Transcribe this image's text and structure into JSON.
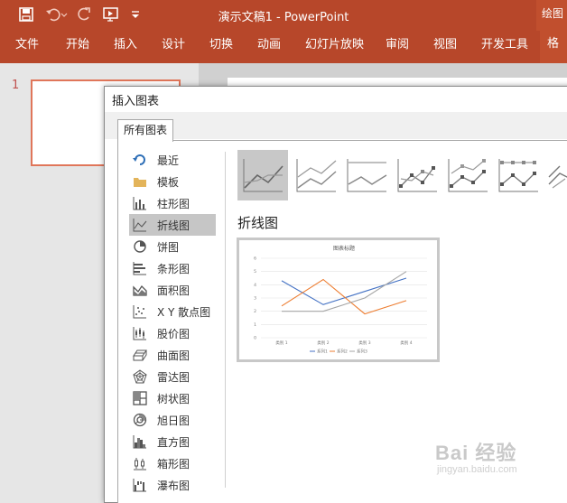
{
  "window": {
    "title": "演示文稿1  -  PowerPoint",
    "right_tab": "绘图"
  },
  "quick_access": [
    "save-icon",
    "undo-icon",
    "redo-icon",
    "slideshow-from-start-icon",
    "customize-icon"
  ],
  "ribbon": {
    "tabs": [
      "文件",
      "开始",
      "插入",
      "设计",
      "切换",
      "动画",
      "幻灯片放映",
      "审阅",
      "视图",
      "开发工具"
    ],
    "contextual_tab": "格"
  },
  "slides": {
    "number": "1"
  },
  "dialog": {
    "title": "插入图表",
    "tab": "所有图表",
    "categories": [
      {
        "label": "最近",
        "icon": "recent-icon"
      },
      {
        "label": "模板",
        "icon": "folder-icon"
      },
      {
        "label": "柱形图",
        "icon": "column-chart-icon"
      },
      {
        "label": "折线图",
        "icon": "line-chart-icon",
        "selected": true
      },
      {
        "label": "饼图",
        "icon": "pie-chart-icon"
      },
      {
        "label": "条形图",
        "icon": "bar-chart-icon"
      },
      {
        "label": "面积图",
        "icon": "area-chart-icon"
      },
      {
        "label": "X Y 散点图",
        "icon": "scatter-chart-icon"
      },
      {
        "label": "股价图",
        "icon": "stock-chart-icon"
      },
      {
        "label": "曲面图",
        "icon": "surface-chart-icon"
      },
      {
        "label": "雷达图",
        "icon": "radar-chart-icon"
      },
      {
        "label": "树状图",
        "icon": "treemap-chart-icon"
      },
      {
        "label": "旭日图",
        "icon": "sunburst-chart-icon"
      },
      {
        "label": "直方图",
        "icon": "histogram-chart-icon"
      },
      {
        "label": "箱形图",
        "icon": "box-whisker-chart-icon"
      },
      {
        "label": "瀑布图",
        "icon": "waterfall-chart-icon"
      }
    ],
    "subtypes": [
      "line",
      "stacked-line",
      "100-percent-stacked-line",
      "line-with-markers",
      "stacked-line-with-markers",
      "100-percent-stacked-line-with-markers",
      "3d-line"
    ],
    "selected_subtype_heading": "折线图",
    "preview": {
      "title": "图表标题",
      "y_ticks": [
        "0",
        "1",
        "2",
        "3",
        "4",
        "5",
        "6"
      ],
      "categories": [
        "类别 1",
        "类别 2",
        "类别 3",
        "类别 4"
      ],
      "legend": [
        "系列1",
        "系列2",
        "系列3"
      ]
    }
  },
  "chart_data": {
    "type": "line",
    "title": "图表标题",
    "categories": [
      "类别 1",
      "类别 2",
      "类别 3",
      "类别 4"
    ],
    "series": [
      {
        "name": "系列1",
        "values": [
          4.3,
          2.5,
          3.5,
          4.5
        ],
        "color": "#4472c4"
      },
      {
        "name": "系列2",
        "values": [
          2.4,
          4.4,
          1.8,
          2.8
        ],
        "color": "#ed7d31"
      },
      {
        "name": "系列3",
        "values": [
          2.0,
          2.0,
          3.0,
          5.0
        ],
        "color": "#a5a5a5"
      }
    ],
    "ylim": [
      0,
      6
    ],
    "grid": true,
    "legend": "bottom"
  },
  "watermark": {
    "logo": "Bai 经验",
    "site": "jingyan.baidu.com"
  }
}
